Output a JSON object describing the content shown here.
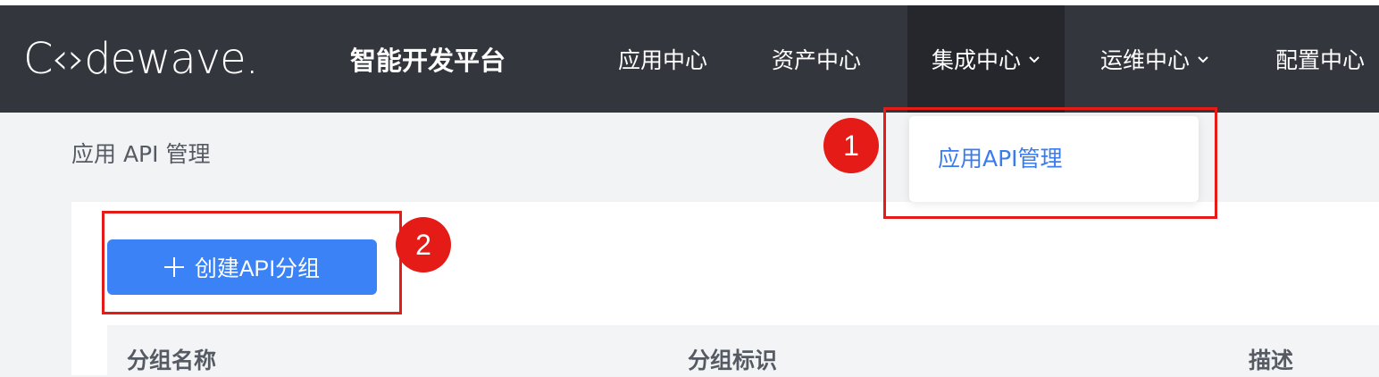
{
  "brand": {
    "logo_text": "C‹›dewave.",
    "platform_name": "智能开发平台"
  },
  "nav": {
    "items": [
      {
        "label": "应用中心",
        "has_dropdown": false
      },
      {
        "label": "资产中心",
        "has_dropdown": false
      },
      {
        "label": "集成中心",
        "has_dropdown": true,
        "active": true
      },
      {
        "label": "运维中心",
        "has_dropdown": true
      },
      {
        "label": "配置中心",
        "has_dropdown": false
      }
    ],
    "dropdown_items": [
      "应用API管理"
    ]
  },
  "page": {
    "title": "应用 API 管理"
  },
  "actions": {
    "create_group_label": "创建API分组"
  },
  "table": {
    "columns": [
      "分组名称",
      "分组标识",
      "描述"
    ]
  },
  "annotations": {
    "callout_1": "1",
    "callout_2": "2"
  },
  "colors": {
    "navbar_bg": "#33363d",
    "active_nav_bg": "#25272c",
    "primary": "#3b82f6",
    "link": "#3a7cf0",
    "annotation_red": "#e41b17"
  }
}
